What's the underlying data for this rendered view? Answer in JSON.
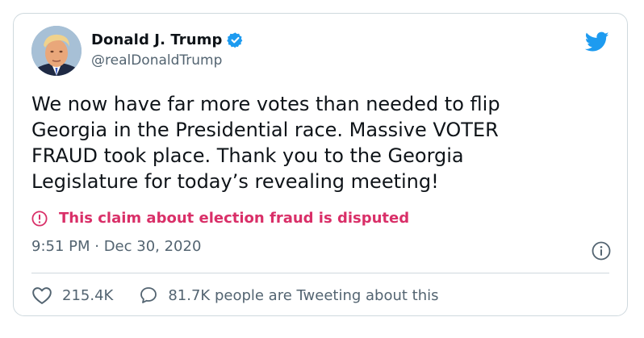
{
  "tweet": {
    "author": {
      "display_name": "Donald J. Trump",
      "handle": "@realDonaldTrump",
      "verified": true,
      "avatar_icon": "profile-photo"
    },
    "text": "We now have far more votes than needed to flip\nGeorgia in the Presidential race. Massive VOTER\nFRAUD took place. Thank you to the Georgia\nLegislature for today’s revealing meeting!",
    "label": {
      "text": "This claim about election fraud is disputed",
      "icon": "exclamation-circle-icon",
      "color": "#d92f68"
    },
    "timestamp": "9:51 PM · Dec 30, 2020",
    "likes": "215.4K",
    "conversation": "81.7K people are Tweeting about this"
  },
  "colors": {
    "twitter_blue": "#1d9bf0",
    "text_primary": "#0f1419",
    "text_secondary": "#536471",
    "border": "#cfd9de"
  }
}
